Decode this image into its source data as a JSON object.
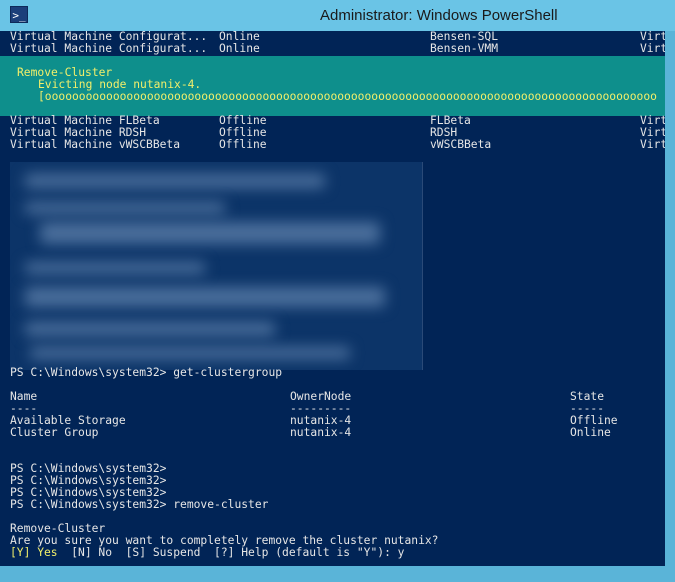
{
  "window": {
    "title": "Administrator: Windows PowerShell",
    "icon": "powershell-icon"
  },
  "colors": {
    "console_bg": "#012456",
    "progress_bg": "#0e8f8c",
    "prompt_yellow": "#f2ef6a",
    "text": "#e6e6e6"
  },
  "top_rows": [
    [
      "Virtual Machine Configurat...",
      "Online",
      "Bensen-SQL",
      "Virtu"
    ],
    [
      "Virtual Machine Configurat...",
      "Online",
      "Bensen-VMM",
      "Virtu"
    ]
  ],
  "progress": {
    "activity": "Remove-Cluster",
    "status": "Evicting node nutanix-4.",
    "bar": "[oooooooooooooooooooooooooooooooooooooooooooooooooooooooooooooooooooooooooooooooooooooooooo"
  },
  "mid_rows": [
    [
      "Virtual Machine FLBeta",
      "Offline",
      "FLBeta",
      "Virtu"
    ],
    [
      "Virtual Machine RDSH",
      "Offline",
      "RDSH",
      "Virtu"
    ],
    [
      "Virtual Machine vWSCBBeta",
      "Offline",
      "vWSCBBeta",
      "Virtu"
    ]
  ],
  "cmd1": "PS C:\\Windows\\system32> get-clustergroup",
  "group_table": {
    "headers": [
      "Name",
      "OwnerNode",
      "State"
    ],
    "underlines": [
      "----",
      "---------",
      "-----"
    ],
    "rows": [
      [
        "Available Storage",
        "nutanix-4",
        "Offline"
      ],
      [
        "Cluster Group",
        "nutanix-4",
        "Online"
      ]
    ]
  },
  "prompts": [
    "PS C:\\Windows\\system32>",
    "PS C:\\Windows\\system32>",
    "PS C:\\Windows\\system32>",
    "PS C:\\Windows\\system32> remove-cluster"
  ],
  "confirm": {
    "title": "Remove-Cluster",
    "question": "Are you sure you want to completely remove the cluster nutanix?",
    "yes": "[Y] Yes",
    "options": "  [N] No  [S] Suspend  [?] Help (default is \"Y\"): y"
  }
}
